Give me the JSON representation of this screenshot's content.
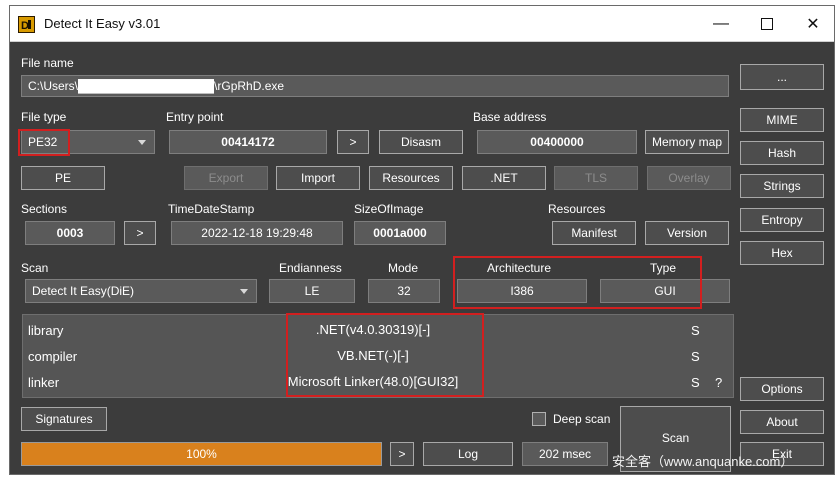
{
  "window": {
    "title": "Detect It Easy v3.01",
    "icon_letter": "D",
    "minimize_glyph": "—",
    "maximize_glyph": "☐",
    "close_glyph": "✕"
  },
  "file": {
    "label": "File name",
    "path": "C:\\Users\\████████████████\\rGpRhD.exe",
    "browse_label": "..."
  },
  "file_type": {
    "label": "File type",
    "value": "PE32"
  },
  "entry_point": {
    "label": "Entry point",
    "value": "00414172",
    "next_label": ">",
    "disasm_label": "Disasm"
  },
  "base_address": {
    "label": "Base address",
    "value": "00400000",
    "memory_map_label": "Memory map"
  },
  "right_tools": [
    "MIME",
    "Hash",
    "Strings",
    "Entropy",
    "Hex"
  ],
  "pe_tabs": {
    "pe": "PE",
    "export": "Export",
    "import": "Import",
    "resources": "Resources",
    "net": ".NET",
    "tls": "TLS",
    "overlay": "Overlay"
  },
  "sections": {
    "label": "Sections",
    "value": "0003",
    "next_label": ">"
  },
  "timestamp": {
    "label": "TimeDateStamp",
    "value": "2022-12-18 19:29:48"
  },
  "size_of_image": {
    "label": "SizeOfImage",
    "value": "0001a000"
  },
  "resources": {
    "label": "Resources",
    "manifest_label": "Manifest",
    "version_label": "Version"
  },
  "scan": {
    "label": "Scan",
    "engine": "Detect It Easy(DiE)",
    "endianness_label": "Endianness",
    "endianness": "LE",
    "mode_label": "Mode",
    "mode": "32",
    "architecture_label": "Architecture",
    "architecture": "I386",
    "type_label": "Type",
    "type": "GUI"
  },
  "results": [
    {
      "kind": "library",
      "name": ".NET(v4.0.30319)[-]",
      "s": "S",
      "q": ""
    },
    {
      "kind": "compiler",
      "name": "VB.NET(-)[-]",
      "s": "S",
      "q": ""
    },
    {
      "kind": "linker",
      "name": "Microsoft Linker(48.0)[GUI32]",
      "s": "S",
      "q": "?"
    }
  ],
  "bottom": {
    "signatures_label": "Signatures",
    "deep_scan_label": "Deep scan",
    "deep_scan_checked": false,
    "scan_label": "Scan",
    "progress_text": "100%",
    "progress_value": 1.0,
    "next_label": ">",
    "log_label": "Log",
    "elapsed": "202 msec",
    "options_label": "Options",
    "about_label": "About",
    "exit_label": "Exit"
  },
  "watermark": "安全客（www.anquanke.com）",
  "colors": {
    "window_bg": "#3c3c3c",
    "field_bg": "#5a5a5a",
    "progress": "#d9811d",
    "highlight": "#d21f1f",
    "app_icon": "#d89a00"
  }
}
